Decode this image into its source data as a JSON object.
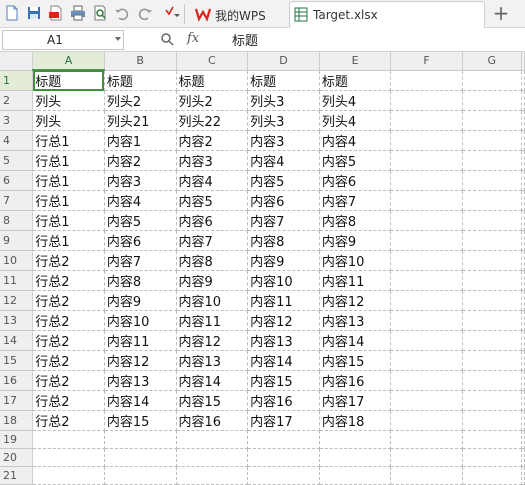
{
  "toolbar": {
    "icons": [
      "new-doc-icon",
      "save-icon",
      "pdf-icon",
      "print-icon",
      "print-preview-icon",
      "undo-icon",
      "redo-icon",
      "dropdown-icon"
    ]
  },
  "tabs": [
    {
      "label": "我的WPS",
      "icon": "wps-logo-icon",
      "active": false
    },
    {
      "label": "Target.xlsx",
      "icon": "spreadsheet-icon",
      "active": true
    }
  ],
  "add_tab_label": "+",
  "formula_bar": {
    "cell_ref": "A1",
    "fx_label": "fx",
    "formula_value": "标题"
  },
  "sheet": {
    "columns": [
      "A",
      "B",
      "C",
      "D",
      "E",
      "F",
      "G"
    ],
    "row_numbers": [
      "1",
      "2",
      "3",
      "4",
      "5",
      "6",
      "7",
      "8",
      "9",
      "10",
      "11",
      "12",
      "13",
      "14",
      "15",
      "16",
      "17",
      "18",
      "19",
      "20",
      "21"
    ],
    "rows": [
      [
        "标题",
        "标题",
        "标题",
        "标题",
        "标题",
        "",
        ""
      ],
      [
        "列头",
        "列头2",
        "列头2",
        "列头3",
        "列头4",
        "",
        ""
      ],
      [
        "列头",
        "列头21",
        "列头22",
        "列头3",
        "列头4",
        "",
        ""
      ],
      [
        "行总1",
        "内容1",
        "内容2",
        "内容3",
        "内容4",
        "",
        ""
      ],
      [
        "行总1",
        "内容2",
        "内容3",
        "内容4",
        "内容5",
        "",
        ""
      ],
      [
        "行总1",
        "内容3",
        "内容4",
        "内容5",
        "内容6",
        "",
        ""
      ],
      [
        "行总1",
        "内容4",
        "内容5",
        "内容6",
        "内容7",
        "",
        ""
      ],
      [
        "行总1",
        "内容5",
        "内容6",
        "内容7",
        "内容8",
        "",
        ""
      ],
      [
        "行总1",
        "内容6",
        "内容7",
        "内容8",
        "内容9",
        "",
        ""
      ],
      [
        "行总2",
        "内容7",
        "内容8",
        "内容9",
        "内容10",
        "",
        ""
      ],
      [
        "行总2",
        "内容8",
        "内容9",
        "内容10",
        "内容11",
        "",
        ""
      ],
      [
        "行总2",
        "内容9",
        "内容10",
        "内容11",
        "内容12",
        "",
        ""
      ],
      [
        "行总2",
        "内容10",
        "内容11",
        "内容12",
        "内容13",
        "",
        ""
      ],
      [
        "行总2",
        "内容11",
        "内容12",
        "内容13",
        "内容14",
        "",
        ""
      ],
      [
        "行总2",
        "内容12",
        "内容13",
        "内容14",
        "内容15",
        "",
        ""
      ],
      [
        "行总2",
        "内容13",
        "内容14",
        "内容15",
        "内容16",
        "",
        ""
      ],
      [
        "行总2",
        "内容14",
        "内容15",
        "内容16",
        "内容17",
        "",
        ""
      ],
      [
        "行总2",
        "内容15",
        "内容16",
        "内容17",
        "内容18",
        "",
        ""
      ],
      [
        "",
        "",
        "",
        "",
        "",
        "",
        ""
      ],
      [
        "",
        "",
        "",
        "",
        "",
        "",
        ""
      ],
      [
        "",
        "",
        "",
        "",
        "",
        "",
        ""
      ]
    ],
    "selected_cell": "A1"
  },
  "colors": {
    "accent": "#217346",
    "wps_red": "#d9251c",
    "selection": "#3f8f3f"
  }
}
